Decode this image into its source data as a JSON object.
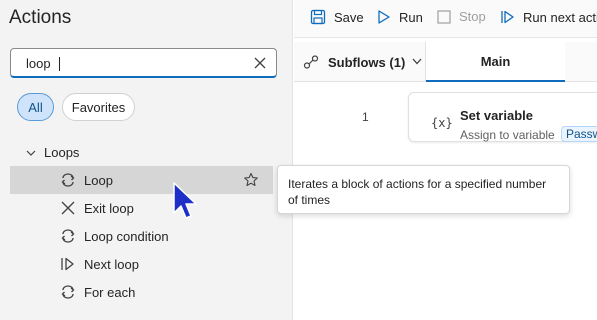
{
  "actions_panel": {
    "title": "Actions",
    "search": {
      "value": "loop",
      "placeholder": ""
    },
    "filters": [
      {
        "label": "All",
        "selected": true
      },
      {
        "label": "Favorites",
        "selected": false
      }
    ],
    "group": {
      "label": "Loops",
      "expanded": true
    },
    "items": [
      {
        "label": "Loop",
        "icon": "loop-icon",
        "selected": true
      },
      {
        "label": "Exit loop",
        "icon": "exit-loop-icon",
        "selected": false
      },
      {
        "label": "Loop condition",
        "icon": "loop-condition-icon",
        "selected": false
      },
      {
        "label": "Next loop",
        "icon": "next-loop-icon",
        "selected": false
      },
      {
        "label": "For each",
        "icon": "for-each-icon",
        "selected": false
      }
    ]
  },
  "tooltip": {
    "text": "Iterates a block of actions for a specified number of times"
  },
  "toolbar": {
    "save_label": "Save",
    "run_label": "Run",
    "stop_label": "Stop",
    "run_next_label": "Run next actio"
  },
  "tabs": {
    "subflows_label": "Subflows (1)",
    "main_label": "Main"
  },
  "flow": {
    "steps": [
      {
        "line": "1",
        "icon_text": "{x}",
        "title": "Set variable",
        "subtitle": "Assign to variable",
        "variable": "Passw"
      }
    ]
  },
  "colors": {
    "accent": "#0f6cbd",
    "selected_row": "#d6d6d6",
    "chip_selected_bg": "#cfe4fa",
    "cursor": "#1e2fc8"
  }
}
